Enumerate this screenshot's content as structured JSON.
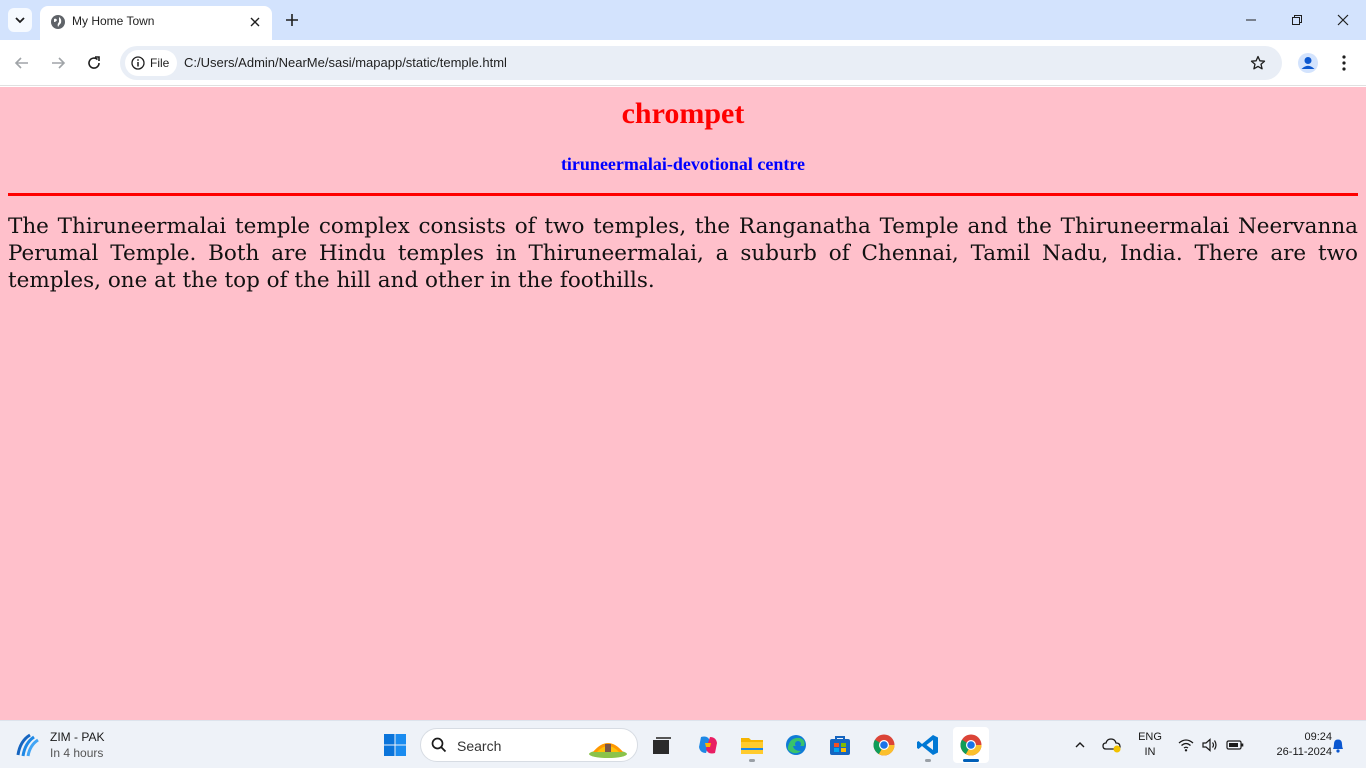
{
  "browser": {
    "tab_title": "My Home Town",
    "site_chip_label": "File",
    "url": "C:/Users/Admin/NearMe/sasi/mapapp/static/temple.html"
  },
  "page": {
    "title": "chrompet",
    "subtitle": "tiruneermalai-devotional centre",
    "paragraph": "The Thiruneermalai temple complex consists of two temples, the Ranganatha Temple and the Thiruneermalai Neervanna Perumal Temple. Both are Hindu temples in Thiruneermalai, a suburb of Chennai, Tamil Nadu, India. There are two temples, one at the top of the hill and other in the foothills.",
    "background_color": "#ffc0cb",
    "title_color": "#ff0000",
    "subtitle_color": "#0000ff",
    "rule_color": "#ff0000"
  },
  "taskbar": {
    "weather_title": "ZIM - PAK",
    "weather_subtitle": "In 4 hours",
    "search_label": "Search",
    "language_top": "ENG",
    "language_bottom": "IN",
    "time": "09:24",
    "date": "26-11-2024"
  }
}
